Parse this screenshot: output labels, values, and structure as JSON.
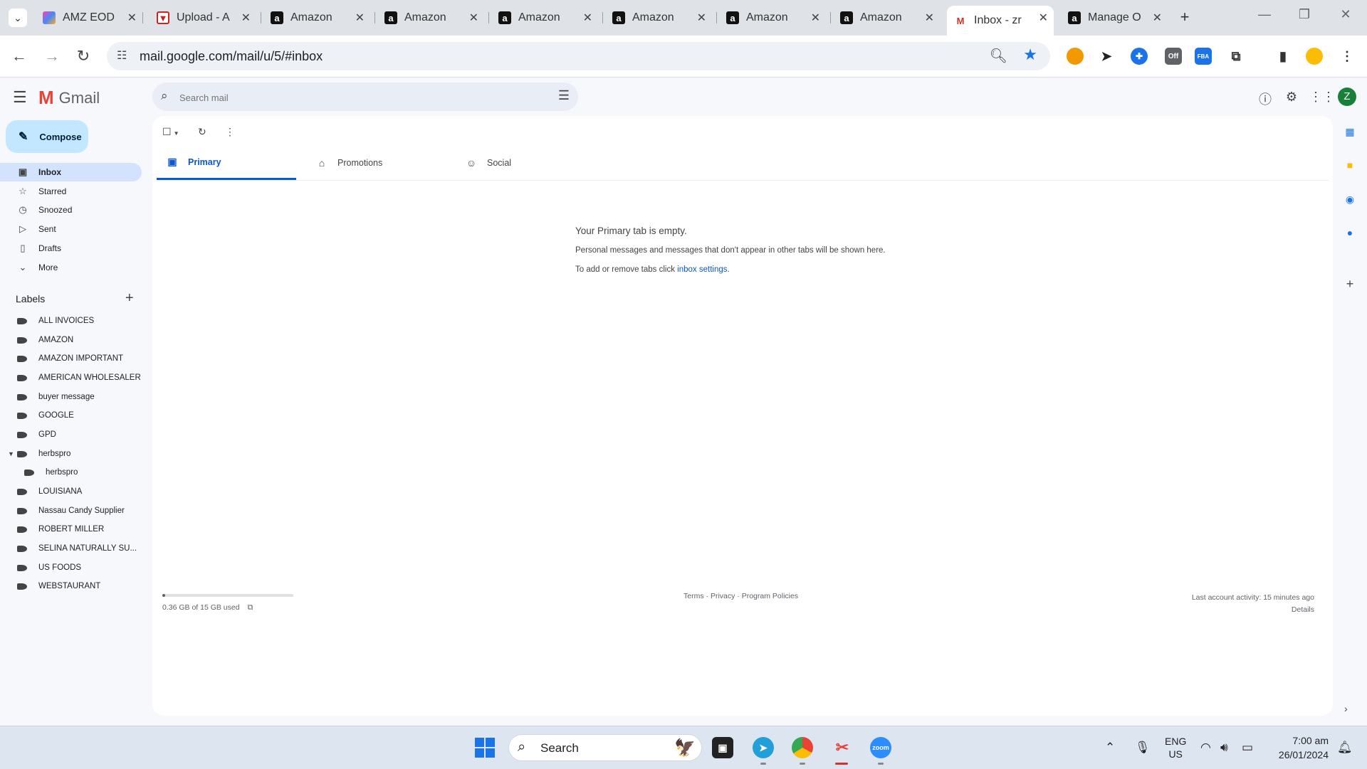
{
  "browser": {
    "tabs": [
      {
        "title": "AMZ EOD",
        "favicon": "amz-eod-icon"
      },
      {
        "title": "Upload - A",
        "favicon": "upload-icon"
      },
      {
        "title": "Amazon",
        "favicon": "amazon-icon"
      },
      {
        "title": "Amazon",
        "favicon": "amazon-icon"
      },
      {
        "title": "Amazon",
        "favicon": "amazon-icon"
      },
      {
        "title": "Amazon",
        "favicon": "amazon-icon"
      },
      {
        "title": "Amazon",
        "favicon": "amazon-icon"
      },
      {
        "title": "Amazon",
        "favicon": "amazon-icon"
      },
      {
        "title": "Inbox - zr",
        "favicon": "gmail-icon",
        "active": true
      },
      {
        "title": "Manage O",
        "favicon": "amazon-icon"
      }
    ],
    "url": "mail.google.com/mail/u/5/#inbox",
    "extension_badge": "Off"
  },
  "gmail": {
    "logo_text": "Gmail",
    "search_placeholder": "Search mail",
    "avatar_initial": "Z",
    "compose_label": "Compose",
    "nav": [
      {
        "label": "Inbox",
        "icon": "inbox-icon",
        "selected": true
      },
      {
        "label": "Starred",
        "icon": "star-icon"
      },
      {
        "label": "Snoozed",
        "icon": "clock-icon"
      },
      {
        "label": "Sent",
        "icon": "send-icon"
      },
      {
        "label": "Drafts",
        "icon": "draft-icon"
      },
      {
        "label": "More",
        "icon": "chevron-down-icon"
      }
    ],
    "labels_heading": "Labels",
    "labels": [
      {
        "name": "ALL INVOICES"
      },
      {
        "name": "AMAZON"
      },
      {
        "name": "AMAZON IMPORTANT"
      },
      {
        "name": "AMERICAN WHOLESALER"
      },
      {
        "name": "buyer message"
      },
      {
        "name": "GOOGLE"
      },
      {
        "name": "GPD"
      },
      {
        "name": "herbspro",
        "expanded": true
      },
      {
        "name": "herbspro",
        "child": true
      },
      {
        "name": "LOUISIANA"
      },
      {
        "name": "Nassau Candy Supplier"
      },
      {
        "name": "ROBERT MILLER"
      },
      {
        "name": "SELINA NATURALLY SU..."
      },
      {
        "name": "US FOODS"
      },
      {
        "name": "WEBSTAURANT"
      }
    ],
    "category_tabs": [
      {
        "label": "Primary",
        "icon": "inbox-icon",
        "active": true
      },
      {
        "label": "Promotions",
        "icon": "tag-icon"
      },
      {
        "label": "Social",
        "icon": "people-icon"
      }
    ],
    "empty_state": {
      "heading": "Your Primary tab is empty.",
      "line1": "Personal messages and messages that don't appear in other tabs will be shown here.",
      "line2_prefix": "To add or remove tabs click ",
      "line2_link": "inbox settings",
      "line2_suffix": "."
    },
    "storage": {
      "text": "0.36 GB of 15 GB used",
      "fraction_used": 0.024
    },
    "footer": {
      "terms": "Terms",
      "privacy": "Privacy",
      "policies": "Program Policies",
      "sep": " · ",
      "last_activity": "Last account activity: 15 minutes ago",
      "details": "Details"
    }
  },
  "taskbar": {
    "search_label": "Search",
    "lang_line1": "ENG",
    "lang_line2": "US",
    "time": "7:00 am",
    "date": "26/01/2024"
  },
  "colors": {
    "accent": "#0b57d0",
    "compose_bg": "#c2e7ff",
    "nav_selected_bg": "#d3e3fd",
    "avatar_bg": "#188038"
  }
}
